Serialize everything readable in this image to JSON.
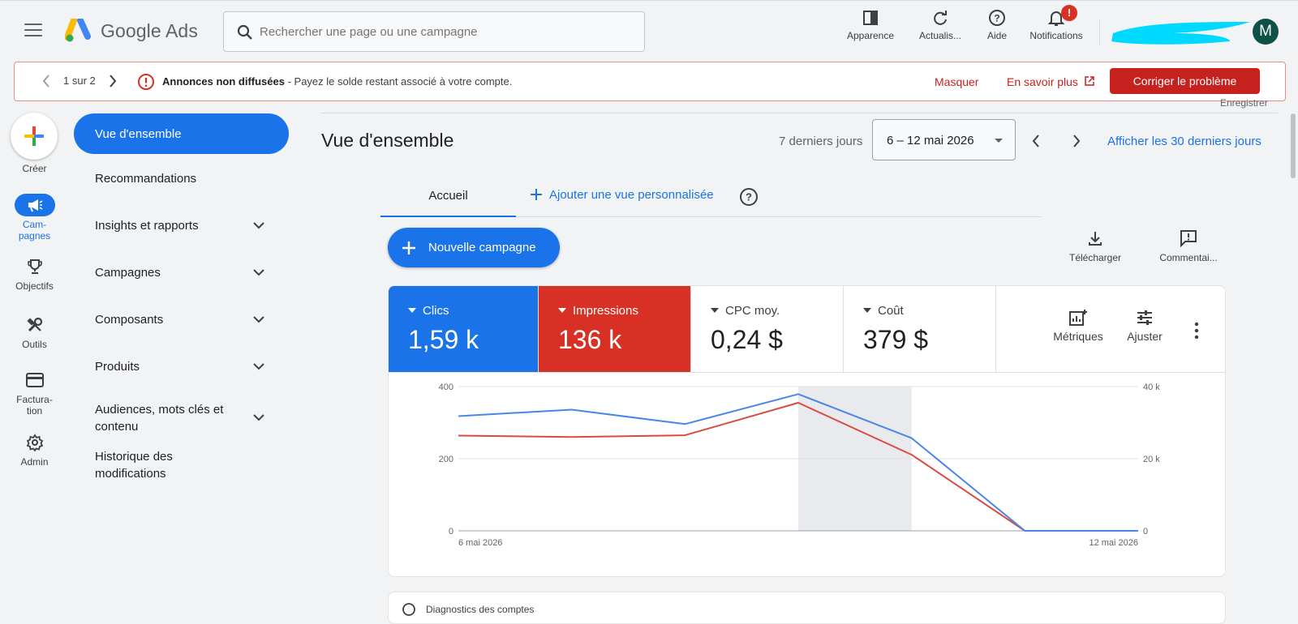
{
  "header": {
    "brand": "Google Ads",
    "search_placeholder": "Rechercher une page ou une campagne",
    "actions": {
      "appearance": "Apparence",
      "refresh": "Actualis...",
      "help": "Aide",
      "notifications": "Notifications"
    },
    "notification_badge": "!",
    "avatar_initial": "M"
  },
  "alert": {
    "page_indicator": "1 sur 2",
    "title": "Annonces non diffusées",
    "message": " - Payez le solde restant associé à votre compte.",
    "dismiss": "Masquer",
    "learn_more": "En savoir plus",
    "fix": "Corriger le problème"
  },
  "rail": {
    "create": "Créer",
    "items": [
      {
        "label1": "Cam-",
        "label2": "pagnes"
      },
      {
        "label1": "Objectifs",
        "label2": ""
      },
      {
        "label1": "Outils",
        "label2": ""
      },
      {
        "label1": "Factura-",
        "label2": "tion"
      },
      {
        "label1": "Admin",
        "label2": ""
      }
    ]
  },
  "nav": {
    "items": [
      "Vue d'ensemble",
      "Recommandations",
      "Insights et rapports",
      "Campagnes",
      "Composants",
      "Produits",
      "Audiences, mots clés et contenu",
      "Historique des modifications"
    ]
  },
  "page": {
    "ghost_text": "Enregistrer",
    "title": "Vue d'ensemble",
    "date_label": "7 derniers jours",
    "date_range": "6 – 12 mai 2026",
    "last30": "Afficher les 30 derniers jours",
    "tabs": {
      "home": "Accueil",
      "add": "Ajouter une vue personnalisée"
    },
    "new_campaign": "Nouvelle campagne",
    "download": "Télécharger",
    "comment": "Commentai..."
  },
  "metrics": [
    {
      "label": "Clics",
      "value": "1,59 k"
    },
    {
      "label": "Impressions",
      "value": "136 k"
    },
    {
      "label": "CPC moy.",
      "value": "0,24 $"
    },
    {
      "label": "Coût",
      "value": "379 $"
    }
  ],
  "card_actions": {
    "metrics": "Métriques",
    "adjust": "Ajuster"
  },
  "colors": {
    "clicks": "#1a73e8",
    "impressions": "#d93025"
  },
  "chart_data": {
    "type": "line",
    "x": [
      "6 mai 2026",
      "7 mai 2026",
      "8 mai 2026",
      "9 mai 2026",
      "10 mai 2026",
      "11 mai 2026",
      "12 mai 2026"
    ],
    "x_tick_labels": [
      "6 mai 2026",
      "12 mai 2026"
    ],
    "y_left_ticks": [
      "400",
      "200",
      "0"
    ],
    "y_right_ticks": [
      "40 k",
      "20 k",
      "0"
    ],
    "ylim_left": [
      0,
      400
    ],
    "ylim_right": [
      0,
      40000
    ],
    "highlight_range": [
      3,
      4
    ],
    "grid": true,
    "series": [
      {
        "key": "Clics",
        "axis": "left",
        "color": "#4a86e8",
        "values": [
          318,
          336,
          296,
          379,
          257,
          0,
          0
        ]
      },
      {
        "key": "Impressions",
        "axis": "right",
        "color": "#db4a3f",
        "values": [
          26400,
          26000,
          26500,
          35500,
          21100,
          0,
          0
        ]
      }
    ]
  },
  "diagnostics": "Diagnostics des comptes"
}
